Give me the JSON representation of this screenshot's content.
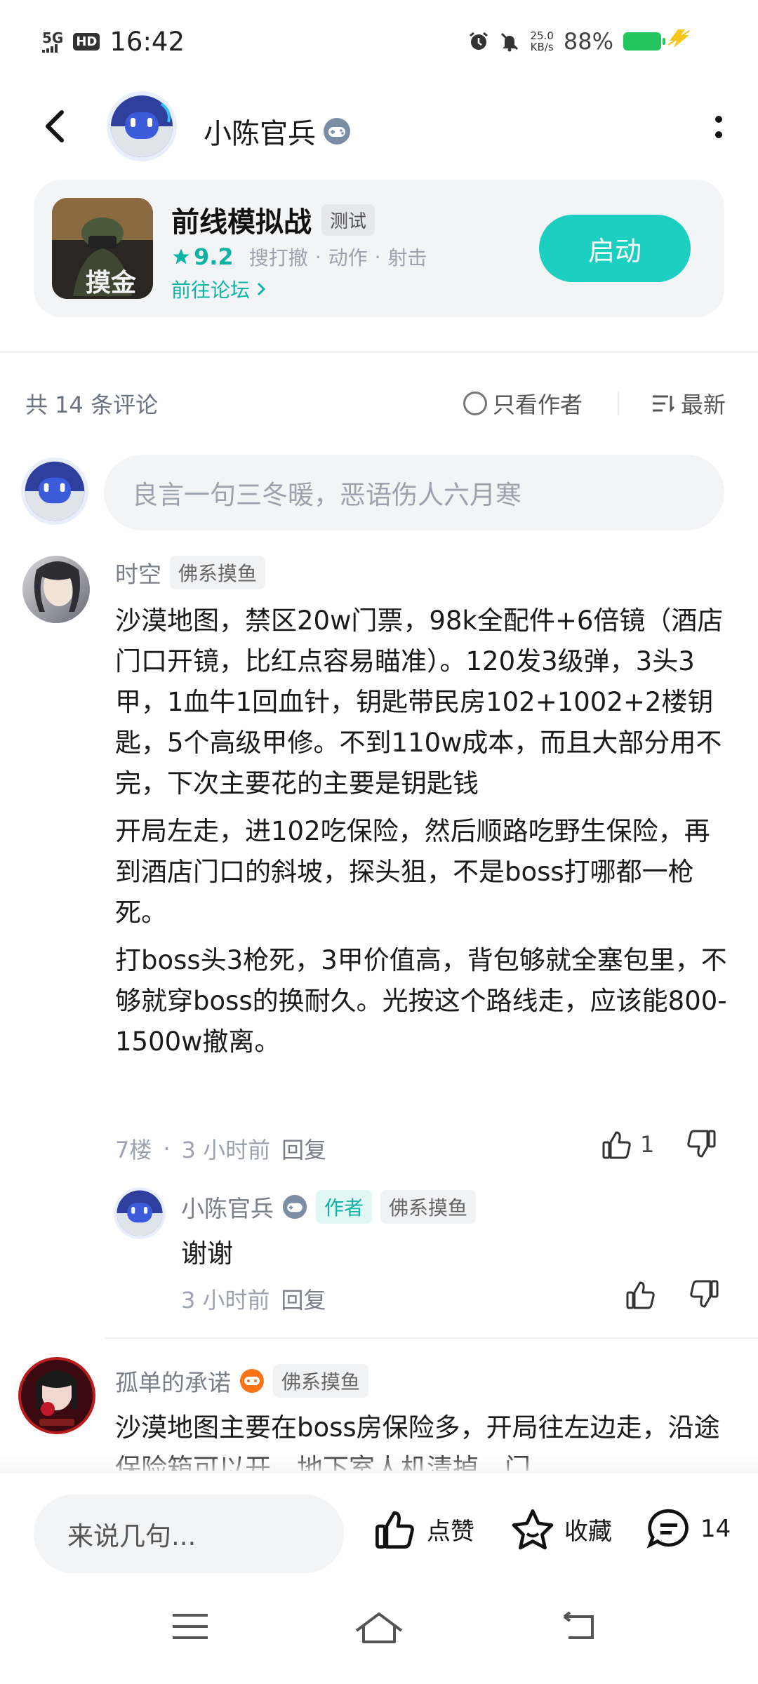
{
  "status_bar": {
    "signal": "5G",
    "hd": "HD",
    "time": "16:42",
    "net_speed_value": "25.0",
    "net_speed_unit": "KB/s",
    "battery": "88%"
  },
  "header": {
    "author_name": "小陈官兵"
  },
  "game": {
    "title": "前线模拟战",
    "test_tag": "测试",
    "rating": "9.2",
    "genres": [
      "搜打撤",
      "动作",
      "射击"
    ],
    "forum_link": "前往论坛",
    "launch_label": "启动",
    "icon_text": "摸金"
  },
  "comments_header": {
    "count_label": "共 14 条评论",
    "only_author_label": "只看作者",
    "sort_label": "最新"
  },
  "comment_input": {
    "placeholder": "良言一句三冬暖，恶语伤人六月寒"
  },
  "comments": [
    {
      "name": "时空",
      "tag": "佛系摸鱼",
      "paragraphs": [
        "沙漠地图，禁区20w门票，98k全配件+6倍镜（酒店门口开镜，比红点容易瞄准）。120发3级弹，3头3甲，1血牛1回血针，钥匙带民房102+1002+2楼钥匙，5个高级甲修。不到110w成本，而且大部分用不完，下次主要花的主要是钥匙钱",
        "开局左走，进102吃保险，然后顺路吃野生保险，再到酒店门口的斜坡，探头狙，不是boss打哪都一枪死。",
        "打boss头3枪死，3甲价值高，背包够就全塞包里，不够就穿boss的换耐久。光按这个路线走，应该能800-1500w撤离。"
      ],
      "floor": "7楼",
      "time": "3 小时前",
      "reply_label": "回复",
      "likes": "1"
    },
    {
      "name": "小陈官兵",
      "author_tag": "作者",
      "tag": "佛系摸鱼",
      "text": "谢谢",
      "time": "3 小时前",
      "reply_label": "回复"
    },
    {
      "name": "孤单的承诺",
      "tag": "佛系摸鱼",
      "text": "沙漠地图主要在boss房保险多，开局往左边走，沿途保险箱可以开，地下室人机清掉，门"
    }
  ],
  "bottom_bar": {
    "input_placeholder": "来说几句...",
    "like_label": "点赞",
    "favorite_label": "收藏",
    "comment_count": "14"
  },
  "colors": {
    "accent": "#1ccfc0",
    "accent_text": "#10b3a3",
    "muted": "#9ca3af"
  }
}
